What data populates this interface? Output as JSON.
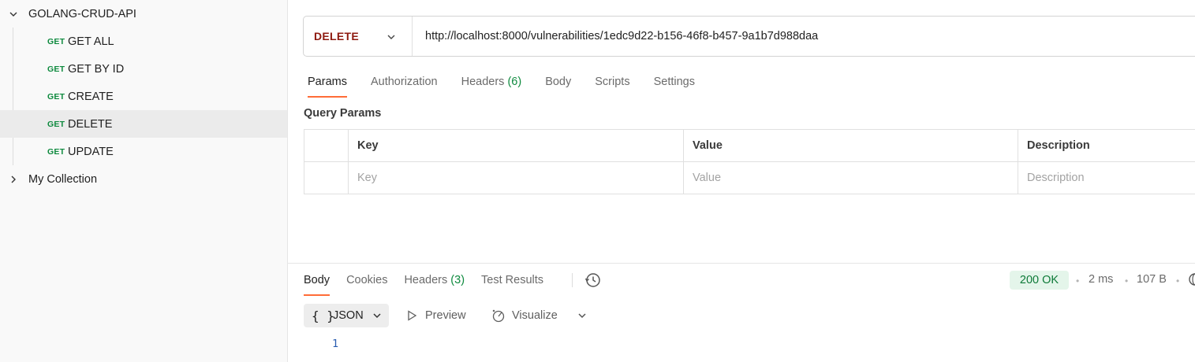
{
  "sidebar": {
    "collections": [
      {
        "name": "GOLANG-CRUD-API",
        "expanded": true
      },
      {
        "name": "My Collection",
        "expanded": false
      }
    ],
    "requests": [
      {
        "method": "GET",
        "name": "GET ALL",
        "selected": false
      },
      {
        "method": "GET",
        "name": "GET BY ID",
        "selected": false
      },
      {
        "method": "GET",
        "name": "CREATE",
        "selected": false
      },
      {
        "method": "GET",
        "name": "DELETE",
        "selected": true
      },
      {
        "method": "GET",
        "name": "UPDATE",
        "selected": false
      }
    ]
  },
  "request": {
    "method": "DELETE",
    "url": "http://localhost:8000/vulnerabilities/1edc9d22-b156-46f8-b457-9a1b7d988daa",
    "tabs": [
      {
        "label": "Params",
        "count": "",
        "active": true
      },
      {
        "label": "Authorization",
        "count": "",
        "active": false
      },
      {
        "label": "Headers",
        "count": "(6)",
        "active": false
      },
      {
        "label": "Body",
        "count": "",
        "active": false
      },
      {
        "label": "Scripts",
        "count": "",
        "active": false
      },
      {
        "label": "Settings",
        "count": "",
        "active": false
      }
    ],
    "query_params": {
      "title": "Query Params",
      "columns": [
        "Key",
        "Value",
        "Description"
      ],
      "placeholders": [
        "Key",
        "Value",
        "Description"
      ]
    }
  },
  "response": {
    "tabs": [
      {
        "label": "Body",
        "count": "",
        "active": true
      },
      {
        "label": "Cookies",
        "count": "",
        "active": false
      },
      {
        "label": "Headers",
        "count": "(3)",
        "active": false
      },
      {
        "label": "Test Results",
        "count": "",
        "active": false
      }
    ],
    "status": "200 OK",
    "time": "2 ms",
    "size": "107 B",
    "format": {
      "braces": "{ }",
      "label": "JSON"
    },
    "preview_label": "Preview",
    "visualize_label": "Visualize",
    "line_number": "1"
  },
  "colors": {
    "accent": "#ff6c37",
    "get_method": "#0e8a3e",
    "delete_method": "#8e1a10",
    "status_ok_bg": "#e4f5ea",
    "status_ok_text": "#0e7a38"
  },
  "icons": [
    "chevron-down-icon",
    "chevron-right-icon",
    "history-icon",
    "globe-icon",
    "play-icon",
    "visualize-icon"
  ]
}
